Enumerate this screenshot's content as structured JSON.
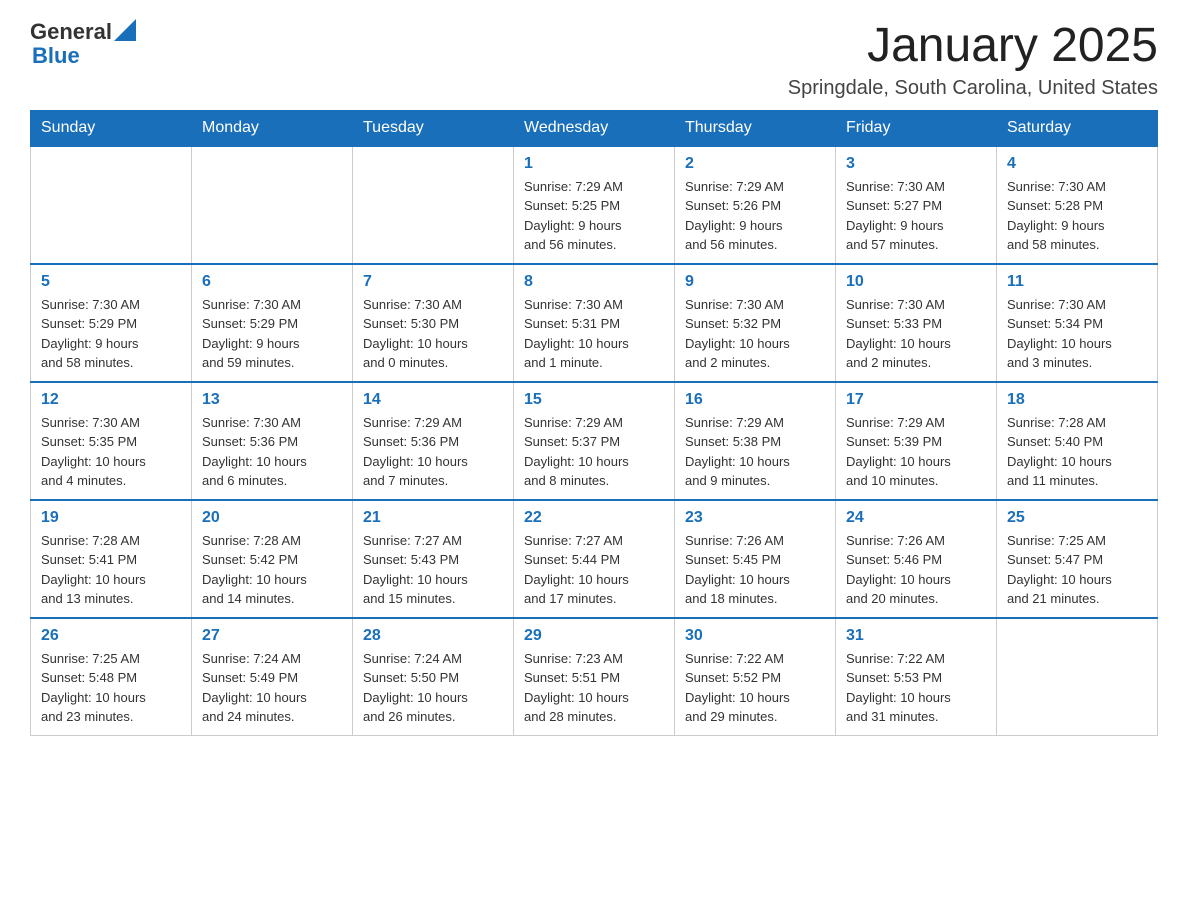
{
  "header": {
    "logo_general": "General",
    "logo_blue": "Blue",
    "month_title": "January 2025",
    "location": "Springdale, South Carolina, United States"
  },
  "days_of_week": [
    "Sunday",
    "Monday",
    "Tuesday",
    "Wednesday",
    "Thursday",
    "Friday",
    "Saturday"
  ],
  "weeks": [
    [
      {
        "day": "",
        "info": ""
      },
      {
        "day": "",
        "info": ""
      },
      {
        "day": "",
        "info": ""
      },
      {
        "day": "1",
        "info": "Sunrise: 7:29 AM\nSunset: 5:25 PM\nDaylight: 9 hours\nand 56 minutes."
      },
      {
        "day": "2",
        "info": "Sunrise: 7:29 AM\nSunset: 5:26 PM\nDaylight: 9 hours\nand 56 minutes."
      },
      {
        "day": "3",
        "info": "Sunrise: 7:30 AM\nSunset: 5:27 PM\nDaylight: 9 hours\nand 57 minutes."
      },
      {
        "day": "4",
        "info": "Sunrise: 7:30 AM\nSunset: 5:28 PM\nDaylight: 9 hours\nand 58 minutes."
      }
    ],
    [
      {
        "day": "5",
        "info": "Sunrise: 7:30 AM\nSunset: 5:29 PM\nDaylight: 9 hours\nand 58 minutes."
      },
      {
        "day": "6",
        "info": "Sunrise: 7:30 AM\nSunset: 5:29 PM\nDaylight: 9 hours\nand 59 minutes."
      },
      {
        "day": "7",
        "info": "Sunrise: 7:30 AM\nSunset: 5:30 PM\nDaylight: 10 hours\nand 0 minutes."
      },
      {
        "day": "8",
        "info": "Sunrise: 7:30 AM\nSunset: 5:31 PM\nDaylight: 10 hours\nand 1 minute."
      },
      {
        "day": "9",
        "info": "Sunrise: 7:30 AM\nSunset: 5:32 PM\nDaylight: 10 hours\nand 2 minutes."
      },
      {
        "day": "10",
        "info": "Sunrise: 7:30 AM\nSunset: 5:33 PM\nDaylight: 10 hours\nand 2 minutes."
      },
      {
        "day": "11",
        "info": "Sunrise: 7:30 AM\nSunset: 5:34 PM\nDaylight: 10 hours\nand 3 minutes."
      }
    ],
    [
      {
        "day": "12",
        "info": "Sunrise: 7:30 AM\nSunset: 5:35 PM\nDaylight: 10 hours\nand 4 minutes."
      },
      {
        "day": "13",
        "info": "Sunrise: 7:30 AM\nSunset: 5:36 PM\nDaylight: 10 hours\nand 6 minutes."
      },
      {
        "day": "14",
        "info": "Sunrise: 7:29 AM\nSunset: 5:36 PM\nDaylight: 10 hours\nand 7 minutes."
      },
      {
        "day": "15",
        "info": "Sunrise: 7:29 AM\nSunset: 5:37 PM\nDaylight: 10 hours\nand 8 minutes."
      },
      {
        "day": "16",
        "info": "Sunrise: 7:29 AM\nSunset: 5:38 PM\nDaylight: 10 hours\nand 9 minutes."
      },
      {
        "day": "17",
        "info": "Sunrise: 7:29 AM\nSunset: 5:39 PM\nDaylight: 10 hours\nand 10 minutes."
      },
      {
        "day": "18",
        "info": "Sunrise: 7:28 AM\nSunset: 5:40 PM\nDaylight: 10 hours\nand 11 minutes."
      }
    ],
    [
      {
        "day": "19",
        "info": "Sunrise: 7:28 AM\nSunset: 5:41 PM\nDaylight: 10 hours\nand 13 minutes."
      },
      {
        "day": "20",
        "info": "Sunrise: 7:28 AM\nSunset: 5:42 PM\nDaylight: 10 hours\nand 14 minutes."
      },
      {
        "day": "21",
        "info": "Sunrise: 7:27 AM\nSunset: 5:43 PM\nDaylight: 10 hours\nand 15 minutes."
      },
      {
        "day": "22",
        "info": "Sunrise: 7:27 AM\nSunset: 5:44 PM\nDaylight: 10 hours\nand 17 minutes."
      },
      {
        "day": "23",
        "info": "Sunrise: 7:26 AM\nSunset: 5:45 PM\nDaylight: 10 hours\nand 18 minutes."
      },
      {
        "day": "24",
        "info": "Sunrise: 7:26 AM\nSunset: 5:46 PM\nDaylight: 10 hours\nand 20 minutes."
      },
      {
        "day": "25",
        "info": "Sunrise: 7:25 AM\nSunset: 5:47 PM\nDaylight: 10 hours\nand 21 minutes."
      }
    ],
    [
      {
        "day": "26",
        "info": "Sunrise: 7:25 AM\nSunset: 5:48 PM\nDaylight: 10 hours\nand 23 minutes."
      },
      {
        "day": "27",
        "info": "Sunrise: 7:24 AM\nSunset: 5:49 PM\nDaylight: 10 hours\nand 24 minutes."
      },
      {
        "day": "28",
        "info": "Sunrise: 7:24 AM\nSunset: 5:50 PM\nDaylight: 10 hours\nand 26 minutes."
      },
      {
        "day": "29",
        "info": "Sunrise: 7:23 AM\nSunset: 5:51 PM\nDaylight: 10 hours\nand 28 minutes."
      },
      {
        "day": "30",
        "info": "Sunrise: 7:22 AM\nSunset: 5:52 PM\nDaylight: 10 hours\nand 29 minutes."
      },
      {
        "day": "31",
        "info": "Sunrise: 7:22 AM\nSunset: 5:53 PM\nDaylight: 10 hours\nand 31 minutes."
      },
      {
        "day": "",
        "info": ""
      }
    ]
  ]
}
